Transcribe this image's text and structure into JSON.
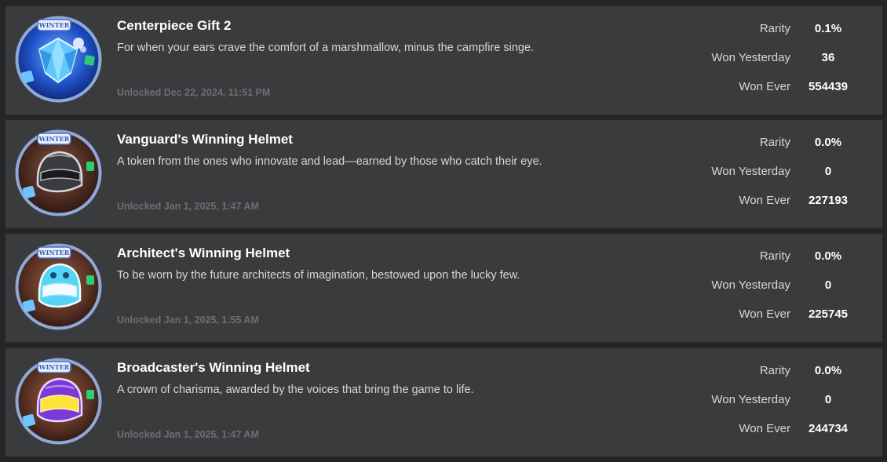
{
  "labels": {
    "rarity": "Rarity",
    "won_yesterday": "Won Yesterday",
    "won_ever": "Won Ever"
  },
  "badges": [
    {
      "title": "Centerpiece Gift 2",
      "description": "For when your ears crave the comfort of a marshmallow, minus the campfire singe.",
      "unlocked": "Unlocked Dec 22, 2024, 11:51 PM",
      "rarity": "0.1%",
      "won_yesterday": "36",
      "won_ever": "554439",
      "icon": "diamond-gift-icon",
      "colors": {
        "bg": "#1f52c8",
        "item": "#5fc8ff"
      }
    },
    {
      "title": "Vanguard's Winning Helmet",
      "description": "A token from the ones who innovate and lead—earned by those who catch their eye.",
      "unlocked": "Unlocked Jan 1, 2025, 1:47 AM",
      "rarity": "0.0%",
      "won_yesterday": "0",
      "won_ever": "227193",
      "icon": "dark-helmet-icon",
      "colors": {
        "bg": "#5a3a2a",
        "item": "#3a3c40"
      }
    },
    {
      "title": "Architect's Winning Helmet",
      "description": "To be worn by the future architects of imagination, bestowed upon the lucky few.",
      "unlocked": "Unlocked Jan 1, 2025, 1:55 AM",
      "rarity": "0.0%",
      "won_yesterday": "0",
      "won_ever": "225745",
      "icon": "cyan-helmet-icon",
      "colors": {
        "bg": "#6a3a2a",
        "item": "#56d4f4"
      }
    },
    {
      "title": "Broadcaster's Winning Helmet",
      "description": "A crown of charisma, awarded by the voices that bring the game to life.",
      "unlocked": "Unlocked Jan 1, 2025, 1:47 AM",
      "rarity": "0.0%",
      "won_yesterday": "0",
      "won_ever": "244734",
      "icon": "purple-yellow-helmet-icon",
      "colors": {
        "bg": "#6a3a2a",
        "item": "#7b3ad8"
      }
    }
  ]
}
